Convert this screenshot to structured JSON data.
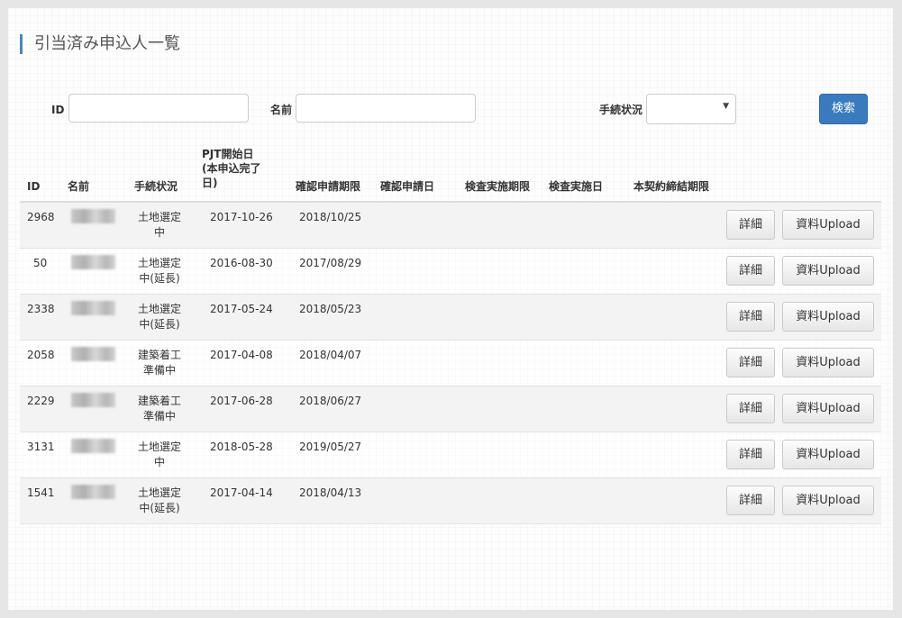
{
  "page": {
    "title": "引当済み申込人一覧"
  },
  "filters": {
    "id_label": "ID",
    "id_value": "",
    "name_label": "名前",
    "name_value": "",
    "status_label": "手続状況",
    "status_value": "",
    "search_button": "検索"
  },
  "table": {
    "headers": {
      "id": "ID",
      "name": "名前",
      "status": "手続状況",
      "pjt_line1": "PJT開始日",
      "pjt_line2": "(本申込完了",
      "pjt_line3": "日)",
      "confirm_deadline": "確認申請期限",
      "confirm_date": "確認申請日",
      "inspection_deadline": "検査実施期限",
      "inspection_date": "検査実施日",
      "contract_deadline": "本契約締結期限"
    },
    "rows": [
      {
        "id": "2968",
        "status_line1": "土地選定",
        "status_line2": "中",
        "pjt_start": "2017-10-26",
        "confirm_deadline": "2018/10/25"
      },
      {
        "id": "50",
        "status_line1": "土地選定",
        "status_line2": "中(延長)",
        "pjt_start": "2016-08-30",
        "confirm_deadline": "2017/08/29"
      },
      {
        "id": "2338",
        "status_line1": "土地選定",
        "status_line2": "中(延長)",
        "pjt_start": "2017-05-24",
        "confirm_deadline": "2018/05/23"
      },
      {
        "id": "2058",
        "status_line1": "建築着工",
        "status_line2": "準備中",
        "pjt_start": "2017-04-08",
        "confirm_deadline": "2018/04/07"
      },
      {
        "id": "2229",
        "status_line1": "建築着工",
        "status_line2": "準備中",
        "pjt_start": "2017-06-28",
        "confirm_deadline": "2018/06/27"
      },
      {
        "id": "3131",
        "status_line1": "土地選定",
        "status_line2": "中",
        "pjt_start": "2018-05-28",
        "confirm_deadline": "2019/05/27"
      },
      {
        "id": "1541",
        "status_line1": "土地選定",
        "status_line2": "中(延長)",
        "pjt_start": "2017-04-14",
        "confirm_deadline": "2018/04/13"
      }
    ],
    "detail_button": "詳細",
    "upload_button": "資料Upload"
  }
}
